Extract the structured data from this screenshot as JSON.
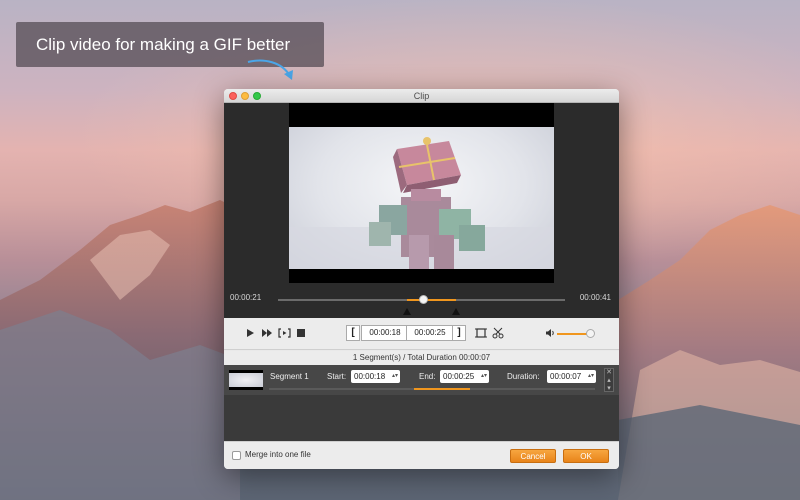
{
  "caption": {
    "text": "Clip video for making a GIF better"
  },
  "window": {
    "title": "Clip"
  },
  "timeline": {
    "start_time": "00:00:21",
    "end_time": "00:00:41",
    "selection_start_fraction": 0.45,
    "selection_end_fraction": 0.62,
    "playhead_fraction": 0.51
  },
  "controls": {
    "play_icon": "play-icon",
    "next_frame_icon": "fast-forward-icon",
    "preview_clip_icon": "preview-clip-icon",
    "stop_icon": "stop-icon",
    "set_start_label": "[",
    "start_time": "00:00:18",
    "end_time": "00:00:25",
    "set_end_label": "]",
    "volume_fraction": 0.9
  },
  "summary": {
    "text": "1 Segment(s) / Total Duration 00:00:07"
  },
  "segments": [
    {
      "name": "Segment 1",
      "start_label": "Start:",
      "start": "00:00:18",
      "end_label": "End:",
      "end": "00:00:25",
      "duration_label": "Duration:",
      "duration": "00:00:07"
    }
  ],
  "footer": {
    "merge_label": "Merge into one file",
    "merge_checked": false,
    "cancel_label": "Cancel",
    "ok_label": "OK"
  },
  "colors": {
    "accent": "#f0961e",
    "preview_bg": "#2b2b2b",
    "segment_bg": "#474747"
  }
}
